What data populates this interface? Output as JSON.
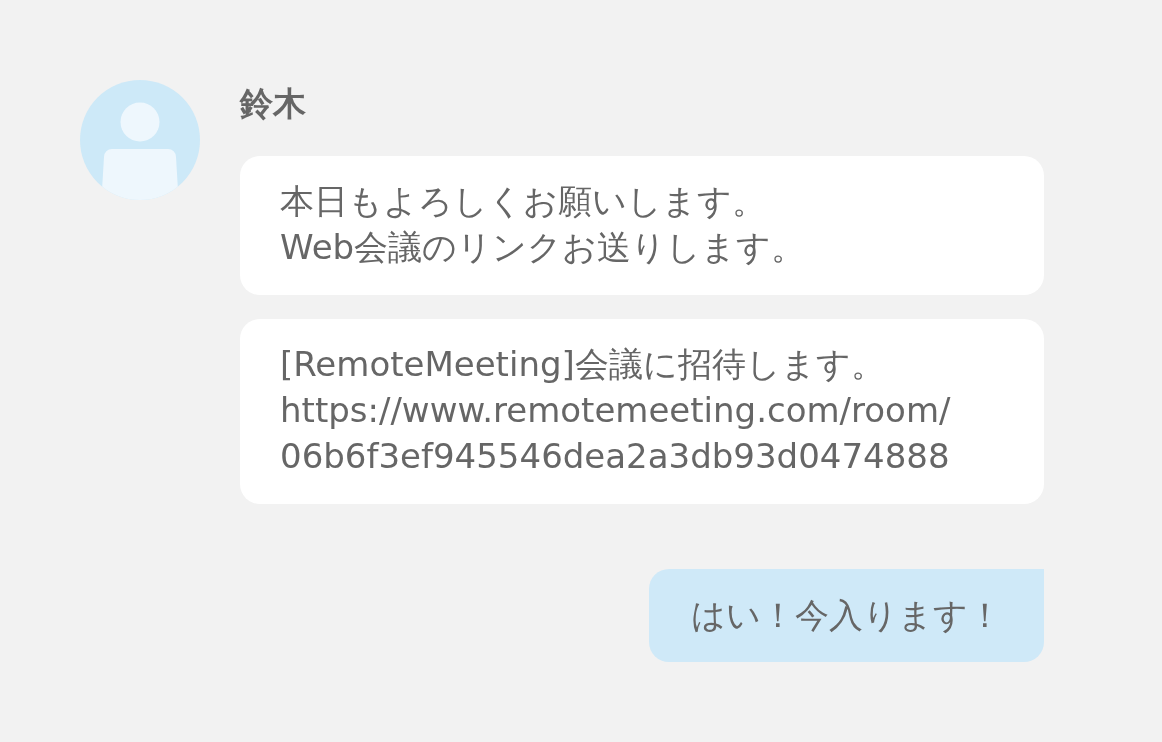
{
  "messages": [
    {
      "kind": "received",
      "sender": "鈴木",
      "bubbles": [
        {
          "lines": [
            "本日もよろしくお願いします。",
            "Web会議のリンクお送りします。"
          ]
        },
        {
          "lines": [
            "[RemoteMeeting]会議に招待します。",
            "https://www.remotemeeting.com/room/",
            "06b6f3ef945546dea2a3db93d0474888"
          ]
        }
      ]
    },
    {
      "kind": "sent",
      "bubbles": [
        {
          "lines": [
            "はい！今入ります！"
          ]
        }
      ]
    }
  ]
}
